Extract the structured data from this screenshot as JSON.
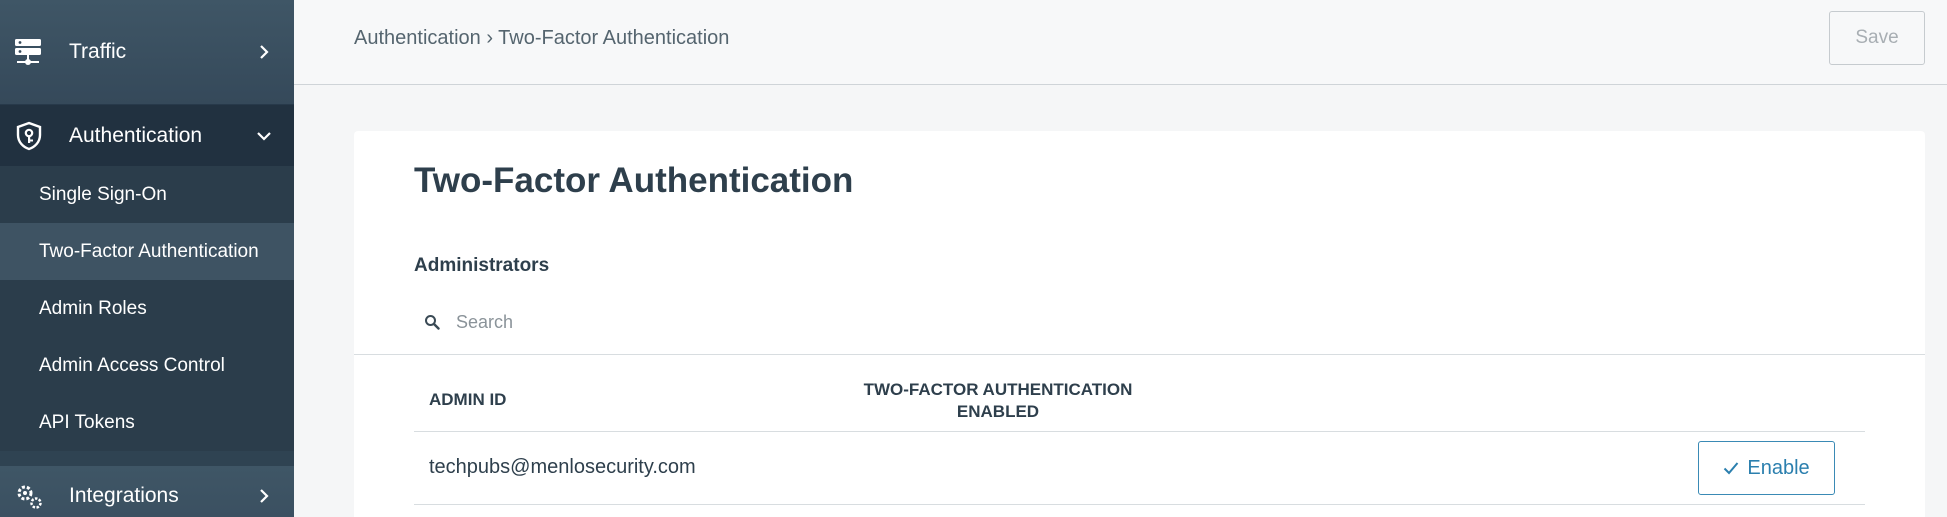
{
  "sidebar": {
    "traffic": {
      "label": "Traffic",
      "icon": "server-icon"
    },
    "authentication": {
      "label": "Authentication",
      "icon": "shield-key-icon",
      "items": [
        {
          "label": "Single Sign-On",
          "active": false
        },
        {
          "label": "Two-Factor Authentication",
          "active": true
        },
        {
          "label": "Admin Roles",
          "active": false
        },
        {
          "label": "Admin Access Control",
          "active": false
        },
        {
          "label": "API Tokens",
          "active": false
        }
      ]
    },
    "integrations": {
      "label": "Integrations",
      "icon": "gears-icon"
    }
  },
  "header": {
    "breadcrumb": "Authentication › Two-Factor Authentication",
    "save_label": "Save"
  },
  "main": {
    "title": "Two-Factor Authentication",
    "section_title": "Administrators",
    "search": {
      "placeholder": "Search",
      "value": ""
    },
    "table": {
      "columns": [
        "ADMIN ID",
        "TWO-FACTOR AUTHENTICATION ENABLED"
      ],
      "column_tfa_line1": "TWO-FACTOR AUTHENTICATION",
      "column_tfa_line2": "ENABLED",
      "rows": [
        {
          "admin_id": "techpubs@menlosecurity.com",
          "action": "Enable"
        }
      ]
    }
  },
  "colors": {
    "sidebar_bg": "#2f4352",
    "accent": "#2b7fae",
    "title_text": "#2e3f4c"
  }
}
